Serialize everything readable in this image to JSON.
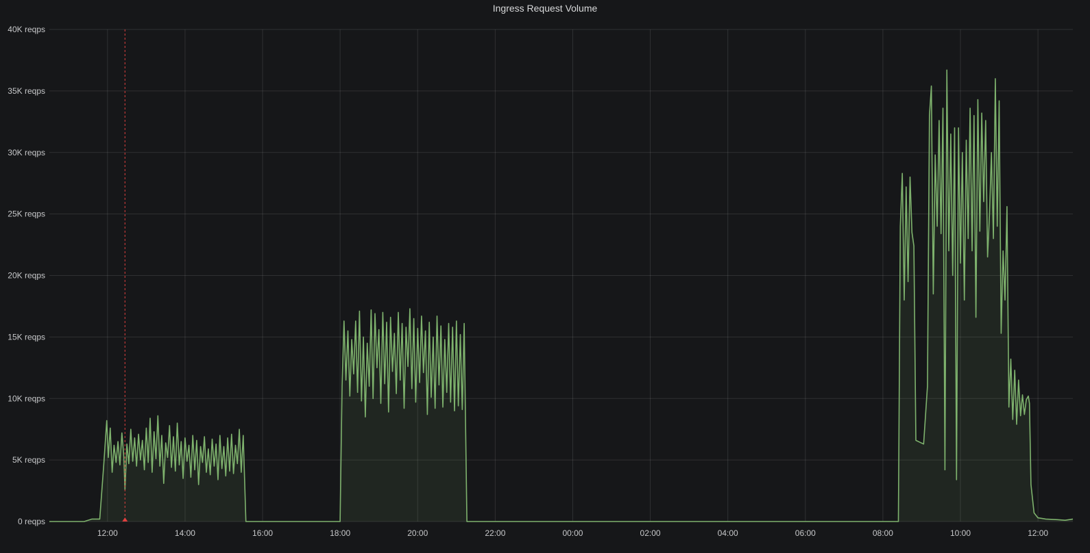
{
  "panel": {
    "title": "Ingress Request Volume"
  },
  "chart_data": {
    "type": "area",
    "title": "Ingress Request Volume",
    "ylim": [
      0,
      40000
    ],
    "y_ticks": [
      {
        "value": 0,
        "label": "0 reqps"
      },
      {
        "value": 5000,
        "label": "5K reqps"
      },
      {
        "value": 10000,
        "label": "10K reqps"
      },
      {
        "value": 15000,
        "label": "15K reqps"
      },
      {
        "value": 20000,
        "label": "20K reqps"
      },
      {
        "value": 25000,
        "label": "25K reqps"
      },
      {
        "value": 30000,
        "label": "30K reqps"
      },
      {
        "value": 35000,
        "label": "35K reqps"
      },
      {
        "value": 40000,
        "label": "40K reqps"
      }
    ],
    "xlim_hours": [
      10.5,
      36.9
    ],
    "x_ticks": [
      {
        "value": 12,
        "label": "12:00"
      },
      {
        "value": 14,
        "label": "14:00"
      },
      {
        "value": 16,
        "label": "16:00"
      },
      {
        "value": 18,
        "label": "18:00"
      },
      {
        "value": 20,
        "label": "20:00"
      },
      {
        "value": 22,
        "label": "22:00"
      },
      {
        "value": 24,
        "label": "00:00"
      },
      {
        "value": 26,
        "label": "02:00"
      },
      {
        "value": 28,
        "label": "04:00"
      },
      {
        "value": 30,
        "label": "06:00"
      },
      {
        "value": 32,
        "label": "08:00"
      },
      {
        "value": 34,
        "label": "10:00"
      },
      {
        "value": 36,
        "label": "12:00"
      }
    ],
    "grid": true,
    "annotation": {
      "x": 12.45,
      "color": "#e0403f"
    },
    "series": [
      {
        "color": "#7eb26d",
        "fill": "rgba(126,178,109,0.10)",
        "points": [
          [
            10.5,
            0
          ],
          [
            11.4,
            0
          ],
          [
            11.6,
            200
          ],
          [
            11.8,
            200
          ],
          [
            11.9,
            4500
          ],
          [
            11.98,
            8200
          ],
          [
            12.02,
            5200
          ],
          [
            12.07,
            7600
          ],
          [
            12.12,
            4000
          ],
          [
            12.17,
            6200
          ],
          [
            12.22,
            4800
          ],
          [
            12.27,
            6500
          ],
          [
            12.32,
            4600
          ],
          [
            12.37,
            7200
          ],
          [
            12.42,
            5300
          ],
          [
            12.45,
            2600
          ],
          [
            12.5,
            6300
          ],
          [
            12.55,
            4700
          ],
          [
            12.6,
            7500
          ],
          [
            12.65,
            4900
          ],
          [
            12.7,
            6800
          ],
          [
            12.75,
            4500
          ],
          [
            12.8,
            7100
          ],
          [
            12.85,
            5000
          ],
          [
            12.9,
            6600
          ],
          [
            12.95,
            4200
          ],
          [
            13.0,
            7600
          ],
          [
            13.05,
            4800
          ],
          [
            13.1,
            8400
          ],
          [
            13.15,
            4000
          ],
          [
            13.2,
            7300
          ],
          [
            13.25,
            5100
          ],
          [
            13.3,
            8600
          ],
          [
            13.35,
            4500
          ],
          [
            13.4,
            7000
          ],
          [
            13.45,
            3100
          ],
          [
            13.5,
            6400
          ],
          [
            13.55,
            5200
          ],
          [
            13.6,
            7800
          ],
          [
            13.65,
            4400
          ],
          [
            13.7,
            6900
          ],
          [
            13.75,
            4100
          ],
          [
            13.8,
            8000
          ],
          [
            13.85,
            4600
          ],
          [
            13.9,
            6500
          ],
          [
            13.95,
            3500
          ],
          [
            14.0,
            6800
          ],
          [
            14.05,
            4900
          ],
          [
            14.1,
            6200
          ],
          [
            14.15,
            3600
          ],
          [
            14.2,
            7000
          ],
          [
            14.25,
            4200
          ],
          [
            14.3,
            6600
          ],
          [
            14.35,
            3000
          ],
          [
            14.4,
            6100
          ],
          [
            14.45,
            4800
          ],
          [
            14.5,
            6900
          ],
          [
            14.55,
            4000
          ],
          [
            14.6,
            5900
          ],
          [
            14.65,
            3800
          ],
          [
            14.7,
            6700
          ],
          [
            14.75,
            4500
          ],
          [
            14.8,
            6300
          ],
          [
            14.85,
            3400
          ],
          [
            14.9,
            7000
          ],
          [
            14.95,
            4300
          ],
          [
            15.0,
            6100
          ],
          [
            15.05,
            3700
          ],
          [
            15.1,
            6800
          ],
          [
            15.15,
            4100
          ],
          [
            15.2,
            7100
          ],
          [
            15.25,
            3900
          ],
          [
            15.3,
            6200
          ],
          [
            15.35,
            4700
          ],
          [
            15.4,
            7500
          ],
          [
            15.45,
            4000
          ],
          [
            15.5,
            7000
          ],
          [
            15.57,
            0
          ],
          [
            18.0,
            0
          ],
          [
            18.05,
            11000
          ],
          [
            18.1,
            16300
          ],
          [
            18.15,
            11500
          ],
          [
            18.2,
            15500
          ],
          [
            18.25,
            10200
          ],
          [
            18.3,
            14800
          ],
          [
            18.35,
            12000
          ],
          [
            18.4,
            16300
          ],
          [
            18.45,
            10500
          ],
          [
            18.5,
            17100
          ],
          [
            18.55,
            9800
          ],
          [
            18.6,
            15000
          ],
          [
            18.65,
            8500
          ],
          [
            18.7,
            14500
          ],
          [
            18.75,
            11000
          ],
          [
            18.8,
            17200
          ],
          [
            18.85,
            10000
          ],
          [
            18.9,
            16900
          ],
          [
            18.95,
            12500
          ],
          [
            19.0,
            15600
          ],
          [
            19.05,
            9600
          ],
          [
            19.1,
            17000
          ],
          [
            19.15,
            11200
          ],
          [
            19.2,
            16200
          ],
          [
            19.25,
            8900
          ],
          [
            19.3,
            16600
          ],
          [
            19.35,
            12200
          ],
          [
            19.4,
            15300
          ],
          [
            19.45,
            10400
          ],
          [
            19.5,
            17000
          ],
          [
            19.55,
            11500
          ],
          [
            19.6,
            16100
          ],
          [
            19.65,
            9200
          ],
          [
            19.7,
            15800
          ],
          [
            19.75,
            12600
          ],
          [
            19.8,
            17300
          ],
          [
            19.85,
            10800
          ],
          [
            19.9,
            16500
          ],
          [
            19.95,
            9700
          ],
          [
            20.0,
            15700
          ],
          [
            20.05,
            11300
          ],
          [
            20.1,
            16700
          ],
          [
            20.15,
            12100
          ],
          [
            20.2,
            15500
          ],
          [
            20.25,
            8700
          ],
          [
            20.3,
            16200
          ],
          [
            20.35,
            10100
          ],
          [
            20.4,
            15000
          ],
          [
            20.45,
            9200
          ],
          [
            20.5,
            16700
          ],
          [
            20.55,
            11100
          ],
          [
            20.6,
            15900
          ],
          [
            20.65,
            9300
          ],
          [
            20.7,
            14800
          ],
          [
            20.75,
            10500
          ],
          [
            20.8,
            16100
          ],
          [
            20.85,
            9700
          ],
          [
            20.9,
            15800
          ],
          [
            20.95,
            9000
          ],
          [
            21.0,
            16300
          ],
          [
            21.05,
            9400
          ],
          [
            21.1,
            15200
          ],
          [
            21.15,
            9100
          ],
          [
            21.2,
            16100
          ],
          [
            21.27,
            0
          ],
          [
            32.4,
            0
          ],
          [
            32.45,
            24000
          ],
          [
            32.5,
            28300
          ],
          [
            32.55,
            18000
          ],
          [
            32.6,
            27200
          ],
          [
            32.65,
            19500
          ],
          [
            32.7,
            28000
          ],
          [
            32.75,
            23500
          ],
          [
            32.8,
            22400
          ],
          [
            32.85,
            6600
          ],
          [
            33.05,
            6300
          ],
          [
            33.15,
            11000
          ],
          [
            33.2,
            33000
          ],
          [
            33.25,
            35400
          ],
          [
            33.3,
            18500
          ],
          [
            33.35,
            29800
          ],
          [
            33.4,
            24000
          ],
          [
            33.45,
            32600
          ],
          [
            33.5,
            23400
          ],
          [
            33.55,
            33600
          ],
          [
            33.6,
            4200
          ],
          [
            33.65,
            36700
          ],
          [
            33.7,
            22000
          ],
          [
            33.75,
            31500
          ],
          [
            33.8,
            20000
          ],
          [
            33.85,
            32000
          ],
          [
            33.9,
            3400
          ],
          [
            33.95,
            32000
          ],
          [
            34.0,
            21000
          ],
          [
            34.05,
            30000
          ],
          [
            34.1,
            18000
          ],
          [
            34.15,
            31000
          ],
          [
            34.2,
            23000
          ],
          [
            34.25,
            33600
          ],
          [
            34.3,
            22000
          ],
          [
            34.35,
            33000
          ],
          [
            34.4,
            16600
          ],
          [
            34.45,
            34300
          ],
          [
            34.5,
            23600
          ],
          [
            34.55,
            33200
          ],
          [
            34.6,
            26000
          ],
          [
            34.65,
            32600
          ],
          [
            34.7,
            21500
          ],
          [
            34.75,
            25000
          ],
          [
            34.8,
            30000
          ],
          [
            34.85,
            23000
          ],
          [
            34.9,
            36000
          ],
          [
            34.95,
            24000
          ],
          [
            35.0,
            34200
          ],
          [
            35.05,
            15300
          ],
          [
            35.1,
            22000
          ],
          [
            35.15,
            18000
          ],
          [
            35.2,
            25600
          ],
          [
            35.25,
            9300
          ],
          [
            35.3,
            13200
          ],
          [
            35.35,
            8300
          ],
          [
            35.4,
            12300
          ],
          [
            35.45,
            7900
          ],
          [
            35.5,
            11500
          ],
          [
            35.55,
            8600
          ],
          [
            35.6,
            10300
          ],
          [
            35.65,
            8700
          ],
          [
            35.7,
            9900
          ],
          [
            35.75,
            10200
          ],
          [
            35.78,
            9600
          ],
          [
            35.82,
            3000
          ],
          [
            35.9,
            700
          ],
          [
            36.0,
            300
          ],
          [
            36.2,
            200
          ],
          [
            36.5,
            150
          ],
          [
            36.7,
            100
          ],
          [
            36.9,
            200
          ]
        ]
      }
    ]
  }
}
